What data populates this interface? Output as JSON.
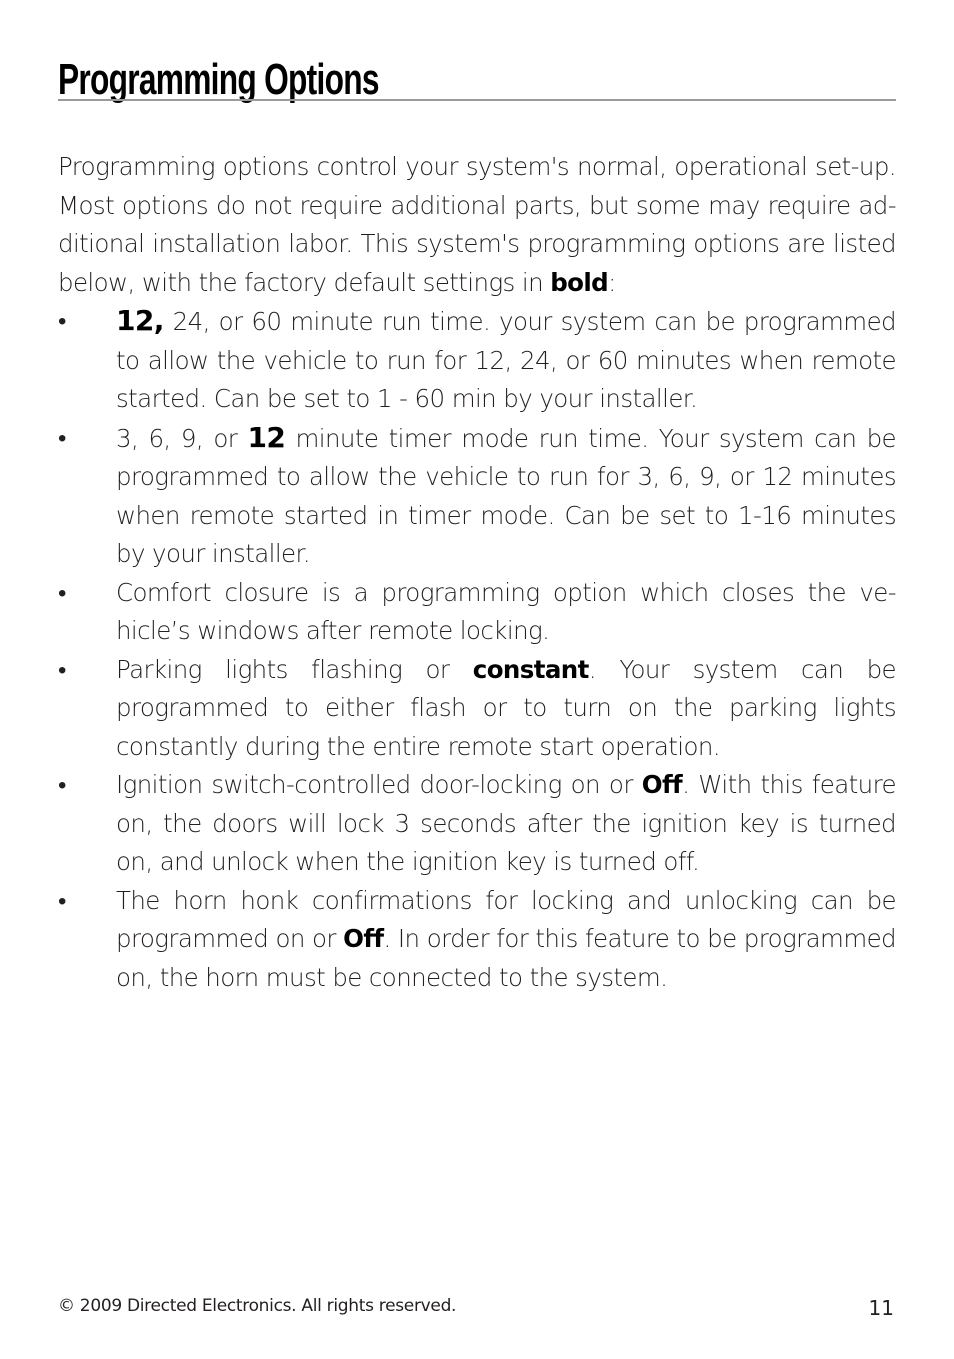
{
  "header": {
    "title": "Programming Options"
  },
  "intro": {
    "text": "Programming options control your system's normal, operational set-up. Most options do not require additional parts, but some may require ad-ditional installation labor. This system's programming options are listed below, with the factory default settings in ",
    "bold_word": "bold",
    "suffix": ":"
  },
  "bullets": [
    {
      "bullet_glyph": "•",
      "bold_lead": "12,",
      "text": " 24, or 60 minute run time. your system can be programmed to allow the vehicle to run for 12, 24, or 60 minutes when remote started. Can be set to 1 - 60 min by your installer."
    },
    {
      "bullet_glyph": "•",
      "pre": "3, 6, 9, or ",
      "bold": "12",
      "post": " minute timer mode run time. Your system can be programmed to allow the vehicle to run for 3, 6, 9, or 12 minutes when remote started in timer mode. Can be set to 1-16 minutes by your installer."
    },
    {
      "bullet_glyph": "•",
      "text": "Comfort closure is a programming option which closes the ve-hicle’s windows after remote locking."
    },
    {
      "bullet_glyph": "•",
      "pre": "Parking lights flashing or ",
      "bold": "constant",
      "post": ". Your system can be programmed to either flash or to turn on the parking lights constantly during the entire remote start operation."
    },
    {
      "bullet_glyph": "•",
      "pre": "Ignition switch-controlled door-locking on or ",
      "bold": "Off",
      "post": ". With this feature on, the doors will lock 3 seconds after the ignition key is turned on, and unlock when the ignition key is turned off."
    },
    {
      "bullet_glyph": "•",
      "pre": "The horn honk confirmations for locking and unlocking can be programmed on or ",
      "bold": "Off",
      "post": ". In order for this feature to be programmed on, the horn must be connected to the system."
    }
  ],
  "footer": {
    "copyright": "© 2009 Directed Electronics. All rights reserved.",
    "page_number": "11"
  }
}
